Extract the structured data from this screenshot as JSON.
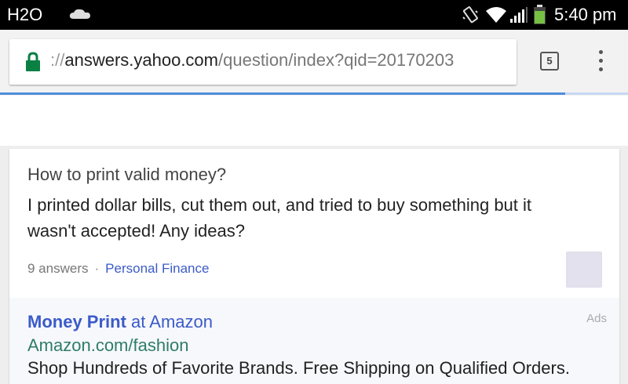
{
  "status_bar": {
    "carrier": "H2O",
    "time": "5:40 pm",
    "icons": [
      "cloud-icon",
      "vibrate-icon",
      "wifi-icon",
      "signal-icon",
      "battery-icon"
    ],
    "battery_color": "#76c043"
  },
  "browser": {
    "url_scheme": "://",
    "url_host": "answers.yahoo.com",
    "url_path": "/question/index?qid=20170203",
    "tab_count": "5",
    "secure_color": "#0b8043",
    "load_progress": 0.9,
    "progress_color": "#4f8edc"
  },
  "question": {
    "title": "How to print valid money?",
    "body": "I printed dollar bills, cut them out, and tried to buy something but it wasn't accepted! Any ideas?",
    "answer_count": "9 answers",
    "separator": "·",
    "category": "Personal Finance"
  },
  "ad": {
    "label": "Ads",
    "title_bold": "Money Print",
    "title_rest": " at Amazon",
    "display_url": "Amazon.com/fashion",
    "description": "Shop Hundreds of Favorite Brands. Free Shipping on Qualified Orders."
  }
}
